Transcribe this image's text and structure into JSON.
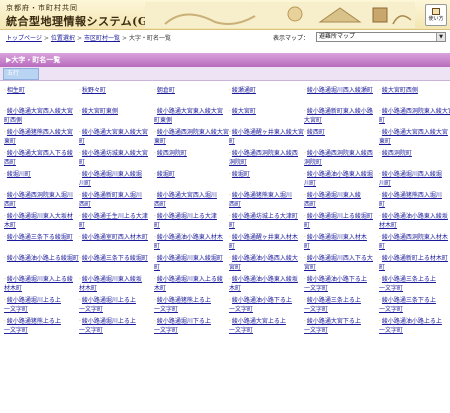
{
  "header": {
    "subtitle": "京都府・市町村共同",
    "title": "統合型地理情報システム(GIS)",
    "help_label": "使い方"
  },
  "breadcrumb": [
    {
      "label": "トップページ",
      "link": true
    },
    {
      "label": "位置選択",
      "link": true
    },
    {
      "label": "市区町村一覧",
      "link": true
    },
    {
      "label": "大字・町名一覧",
      "link": false
    }
  ],
  "map_selector": {
    "label": "表示マップ：",
    "value": "避難所マップ"
  },
  "section": {
    "title": "▶大字・町名一覧",
    "active_tab": "五行"
  },
  "grid_columns": 6,
  "town_items": [
    [
      "相生町"
    ],
    [
      "秋野々町"
    ],
    [
      "朝倉町"
    ],
    [
      "綾瀬通町"
    ],
    [
      "綾小路通堀川西入綾瀬町"
    ],
    [
      "綾大宮町西側"
    ],
    [
      "綾小路通大宮西入綾大宮",
      "町西側"
    ],
    [
      "綾大宮町東側"
    ],
    [
      "綾小路通大宮東入綾大宮",
      "町東側"
    ],
    [
      "綾大宮町"
    ],
    [
      "綾小路通新町東入綾小路",
      "大宮町"
    ],
    [
      "綾小路通西洞院東入綾大宮",
      "町"
    ],
    [
      "綾小路通猪熊西入綾大宮",
      "東町"
    ],
    [
      "綾小路通大宮東入綾大宮",
      "町"
    ],
    [
      "綾小路通西洞院東入綾大宮",
      "東町"
    ],
    [
      "綾小路通醒ヶ井東入綾大宮",
      "町"
    ],
    [
      "綾西町"
    ],
    [
      "綾小路通大宮西入綾大宮",
      "東町"
    ],
    [
      "綾小路通大宮西入下る綾",
      "西町"
    ],
    [
      "綾小路通坊城東入綾大宮",
      "町"
    ],
    [
      "綾西洞院町"
    ],
    [
      "綾小路通西洞院東入綾西",
      "洞院町"
    ],
    [
      "綾小路通西洞院東入綾西",
      "洞院町"
    ],
    [
      "綾西洞院町"
    ],
    [
      "綾堀川町"
    ],
    [
      "綾小路通堀川東入綾堀",
      "川町"
    ],
    [
      "綾堀町"
    ],
    [
      "綾堀町"
    ],
    [
      "綾小路通油小路東入綾堀",
      "川町"
    ],
    [
      "綾小路通堀川西入綾堀",
      "川町"
    ],
    [
      "綾小路通西洞院東入堀川",
      "西町"
    ],
    [
      "綾小路通新町東入堀川",
      "西町"
    ],
    [
      "綾小路通大宮西入堀川",
      "西町"
    ],
    [
      "綾小路通猪熊東入堀川",
      "西町"
    ],
    [
      "綾小路通堀川東入綾",
      "西町"
    ],
    [
      "綾小路通猪熊西入堀川",
      "町"
    ],
    [
      "綾小路通堀川東入大坂材",
      "木町"
    ],
    [
      "綾小路通壬生川上る大津",
      "町"
    ],
    [
      "綾小路通堀川上る大津",
      "町"
    ],
    [
      "綾小路通坊城上る大津町",
      "町"
    ],
    [
      "綾小路通堀川上る綾堀町",
      "町"
    ],
    [
      "綾小路通油小路東入綾坂",
      "材木町"
    ],
    [
      "綾小路通三条下る綾堀町"
    ],
    [
      "綾小路通室町西入材木町"
    ],
    [
      "綾小路通油小路東入材木",
      "町"
    ],
    [
      "綾小路通醒ヶ井東入材木",
      "町"
    ],
    [
      "綾小路通堀川東入材木",
      "町"
    ],
    [
      "綾小路通西洞院東入材木",
      "町"
    ],
    [
      "綾小路通油小路上る綾堀町"
    ],
    [
      "綾小路通三条下る綾堀町"
    ],
    [
      "綾小路通堀川東入綾堀町",
      "町"
    ],
    [
      "綾小路通油小路西入綾大",
      "宮町"
    ],
    [
      "綾小路通堀川西入下る大",
      "宮町"
    ],
    [
      "綾小路通新町上る材木町",
      "町"
    ],
    [
      "綾小路通堀川東入上る綾",
      "材木町"
    ],
    [
      "綾小路通堀川東入綾坂",
      "材木町"
    ],
    [
      "綾小路通堀川東入上る綾",
      "木町"
    ],
    [
      "綾小路通油小路東入綾坂",
      "木町"
    ],
    [
      "綾小路通油小路下る上",
      "一文字町"
    ],
    [
      "綾小路通三条上る上",
      "一文字町"
    ],
    [
      "綾小路通堀川上る上",
      "一文字町"
    ],
    [
      "綾小路通堀川上る上",
      "一文字町"
    ],
    [
      "綾小路通猪熊上る上",
      "一文字町"
    ],
    [
      "綾小路通油小路下る上",
      "一文字町"
    ],
    [
      "綾小路通三条上る上",
      "一文字町"
    ],
    [
      "綾小路通三条下る上",
      "一文字町"
    ],
    [
      "綾小路通猪熊上る上",
      "一文字町"
    ],
    [
      "綾小路通堀川上る上",
      "一文字町"
    ],
    [
      "綾小路通堀川下る上",
      "一文字町"
    ],
    [
      "綾小路通大宮上る上",
      "一文字町"
    ],
    [
      "綾小路通大宮下る上",
      "一文字町"
    ],
    [
      "綾小路通油小路上る上",
      "一文字町"
    ]
  ]
}
